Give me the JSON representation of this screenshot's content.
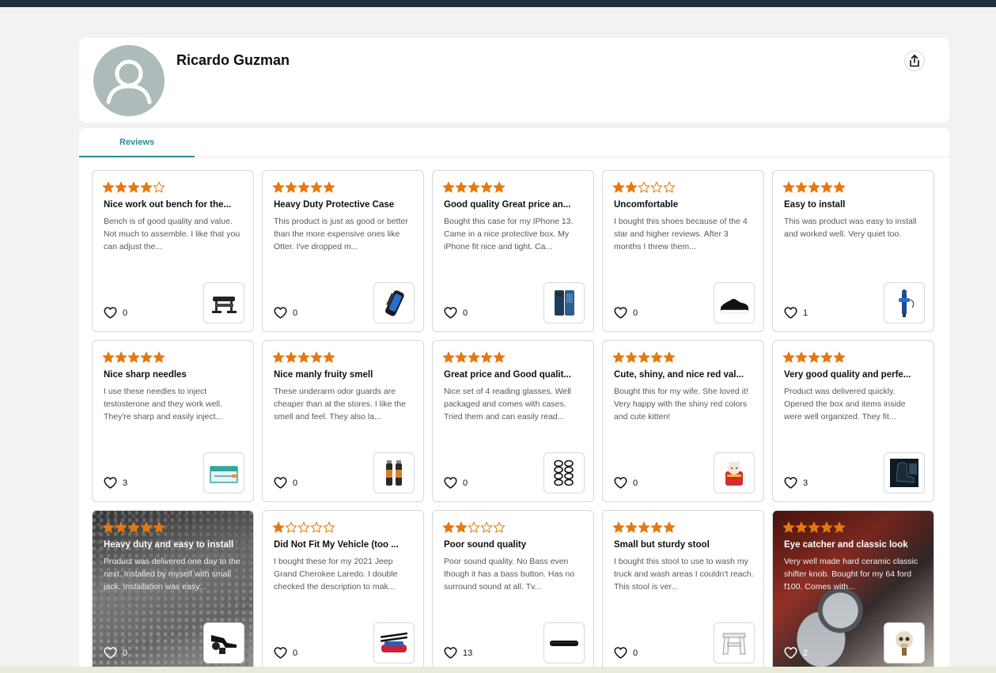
{
  "profile": {
    "name": "Ricardo Guzman",
    "avatar_icon": "user-silhouette-icon",
    "share_icon": "share-icon"
  },
  "tabs": {
    "reviews": "Reviews"
  },
  "colors": {
    "star": "#e47911",
    "tab_accent": "#2a8a97",
    "avatar_bg": "#aebbbb"
  },
  "reviews": [
    {
      "rating": 4,
      "title": "Nice work out bench for the...",
      "body": "Bench is of good quality and value. Not much to assemble. I like that you can adjust the...",
      "likes": "0",
      "product_icon": "workout-bench",
      "background": "none"
    },
    {
      "rating": 5,
      "title": "Heavy Duty Protective Case",
      "body": "This product is just as good or better than the more expensive ones like Otter. I've dropped m...",
      "likes": "0",
      "product_icon": "phone-case",
      "background": "none"
    },
    {
      "rating": 5,
      "title": "Good quality Great price an...",
      "body": "Bought this case for my IPhone 13. Came in a nice protective box. My iPhone fit nice and tight. Ca...",
      "likes": "0",
      "product_icon": "wallet-case",
      "background": "none"
    },
    {
      "rating": 2,
      "title": "Uncomfortable",
      "body": "I bought this shoes because of the 4 star and higher reviews. After 3 months I threw them...",
      "likes": "0",
      "product_icon": "sneaker",
      "background": "none"
    },
    {
      "rating": 5,
      "title": "Easy to install",
      "body": "This was product was easy to install and worked well. Very quiet too.",
      "likes": "1",
      "product_icon": "fill-valve",
      "background": "none"
    },
    {
      "rating": 5,
      "title": "Nice sharp needles",
      "body": "I use these needles to inject testosterone and they work well. They're sharp and easily inject...",
      "likes": "3",
      "product_icon": "needle-box",
      "background": "none"
    },
    {
      "rating": 5,
      "title": "Nice manly fruity smell",
      "body": "These underarm odor guards are cheaper than at the stores. I like the smell and feel. They also la...",
      "likes": "0",
      "product_icon": "deodorant",
      "background": "none"
    },
    {
      "rating": 5,
      "title": "Great price and Good qualit...",
      "body": "Nice set of 4 reading glasses. Well packaged and comes with cases. Tried them and can easily read...",
      "likes": "0",
      "product_icon": "reading-glasses",
      "background": "none"
    },
    {
      "rating": 5,
      "title": "Cute, shiny, and nice red val...",
      "body": "Bought this for my wife. She loved it! Very happy with the shiny red colors and cute kitten!",
      "likes": "0",
      "product_icon": "kitten-figurine",
      "background": "none"
    },
    {
      "rating": 5,
      "title": "Very good quality and perfe...",
      "body": "Product was delivered quickly. Opened the box and items inside were well organized. They fit...",
      "likes": "3",
      "product_icon": "seat-cover",
      "background": "none"
    },
    {
      "rating": 5,
      "title": "Heavy duty and easy to install",
      "body": "Product was delivered one day to the next. Installed by myself with small jack. Installation was easy...",
      "likes": "0",
      "product_icon": "tow-hitch",
      "background": "gravel"
    },
    {
      "rating": 1,
      "title": "Did Not Fit My Vehicle (too ...",
      "body": "I bought these for my 2021 Jeep Grand Cherokee Laredo. I double checked the description to mak...",
      "likes": "0",
      "product_icon": "roof-rack",
      "background": "none"
    },
    {
      "rating": 2,
      "title": "Poor sound quality",
      "body": "Poor sound quality. No Bass even though it has a bass button. Has no surround sound at all. Tv...",
      "likes": "13",
      "product_icon": "soundbar",
      "background": "none"
    },
    {
      "rating": 5,
      "title": "Small but sturdy stool",
      "body": "I bought this stool to use to wash my truck and wash areas I couldn't reach. This stool is ver...",
      "likes": "0",
      "product_icon": "step-stool",
      "background": "none"
    },
    {
      "rating": 5,
      "title": "Eye catcher and classic look",
      "body": "Very well made hard ceramic classic shifter knob. Bought for my 64 ford f100. Comes with...",
      "likes": "2",
      "product_icon": "shifter-knob",
      "background": "wheel"
    }
  ]
}
